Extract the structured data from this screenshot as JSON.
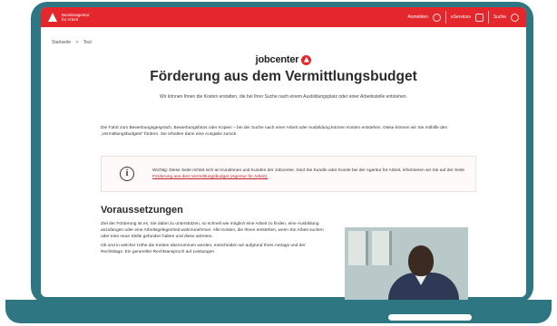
{
  "header": {
    "logo_line1": "Bundesagentur",
    "logo_line2": "für Arbeit",
    "login": "Anmelden",
    "eservices": "eServices",
    "search": "Suche"
  },
  "breadcrumb": {
    "home": "Startseite",
    "sep": ">",
    "current": "Test"
  },
  "brand": {
    "name": "jobcenter"
  },
  "page": {
    "title": "Förderung aus dem Vermittlungsbudget",
    "lead": "Wir können Ihnen die Kosten erstatten, die bei Ihrer Suche nach einem Ausbildungsplatz oder einer Arbeitsstelle entstehen.",
    "para": "Die Fahrt zum Bewerbungsgespräch, Bewerbungsfotos oder Kopien – bei der Suche nach einer Arbeit oder Ausbildung können Kosten entstehen. Diese können wir Sie mithilfe des „Vermittlungsbudgets“ fördern. Sie erhalten dann eine Ausgabe zurück."
  },
  "notice": {
    "text": "Wichtig: Diese Seite richtet sich an Kundinnen und Kunden der Jobcenter. Sind Sie Kundin oder Kunde bei der Agentur für Arbeit, informieren wir Sie auf der Seite ",
    "link": "Förderung aus dem Vermittlungsbudget (Agentur für Arbeit)."
  },
  "requirements": {
    "title": "Voraussetzungen",
    "para1": "Ziel der Förderung ist es, Sie dabei zu unterstützen, so schnell wie möglich eine Arbeit zu finden, eine Ausbildung anzufangen oder eine Arbeitsgelegenheit wahrzunehmen. Alle Kosten, die Ihnen entstehen, wenn Sie Arbeit suchen oder eine neue Stelle gefunden haben und diese antreten.",
    "para2": "Ob und in welcher Höhe die Kosten übernommen werden, entscheiden wir aufgrund Ihres Antrags und der Rechtslage. Ein genereller Rechtsanspruch auf Leistungen"
  }
}
